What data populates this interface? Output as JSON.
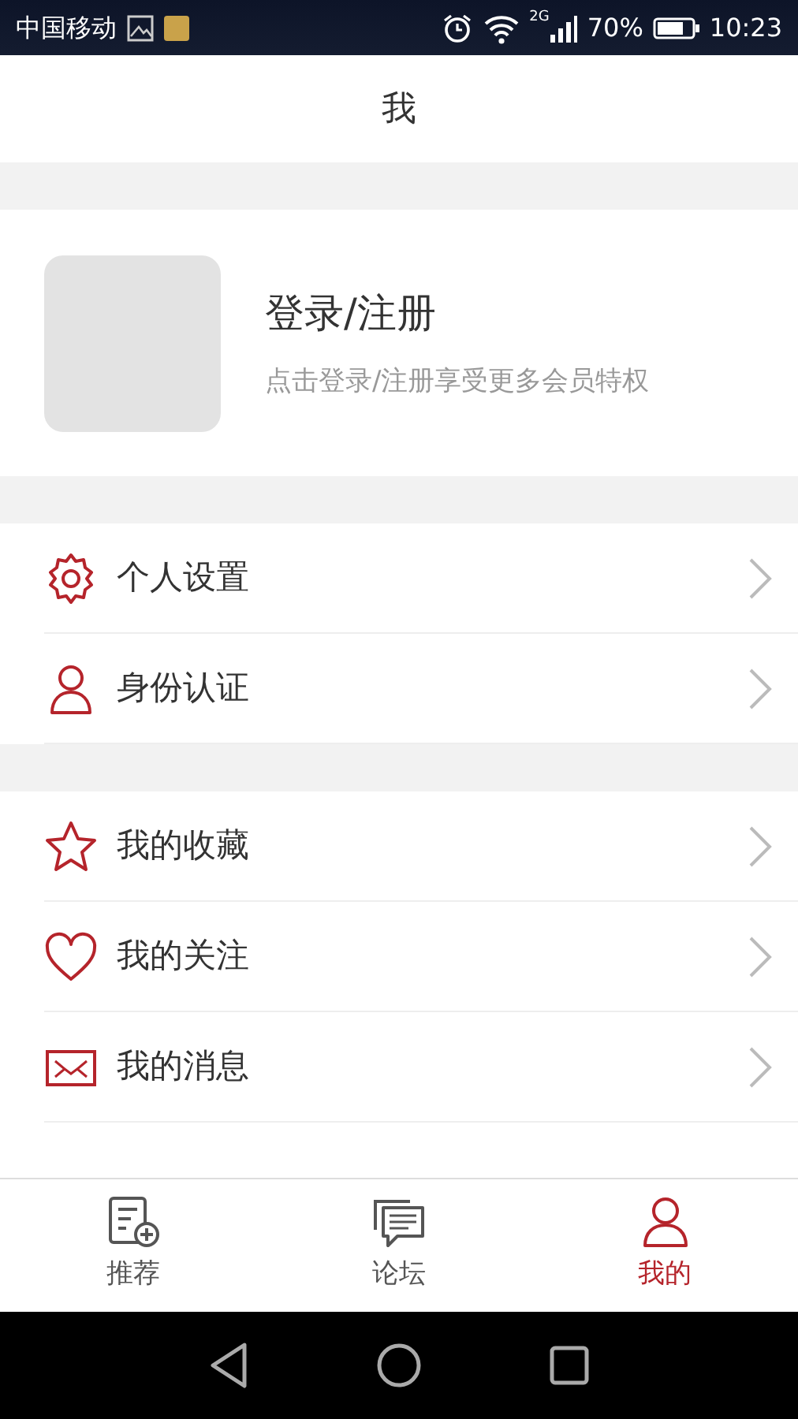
{
  "status_bar": {
    "carrier": "中国移动",
    "network": "2G",
    "battery": "70%",
    "time": "10:23"
  },
  "header": {
    "title": "我"
  },
  "profile": {
    "title": "登录/注册",
    "subtitle": "点击登录/注册享受更多会员特权"
  },
  "menu_groups": [
    {
      "items": [
        {
          "label": "个人设置"
        },
        {
          "label": "身份认证"
        }
      ]
    },
    {
      "items": [
        {
          "label": "我的收藏"
        },
        {
          "label": "我的关注"
        },
        {
          "label": "我的消息"
        }
      ]
    }
  ],
  "tab_bar": [
    {
      "label": "推荐",
      "selected": false
    },
    {
      "label": "论坛",
      "selected": false
    },
    {
      "label": "我的",
      "selected": true
    }
  ]
}
